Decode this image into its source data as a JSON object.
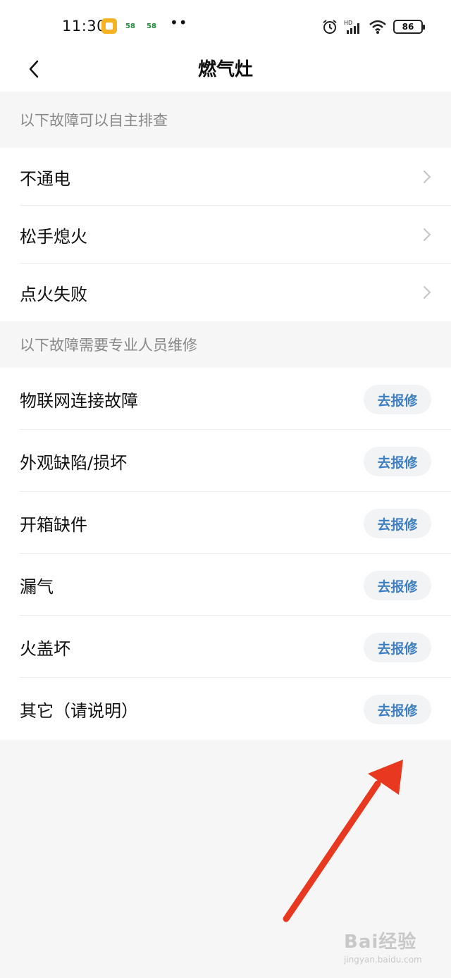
{
  "status_bar": {
    "time": "11:30",
    "app1": "",
    "app2": "58",
    "app3": "58",
    "dots": "••",
    "battery": "86"
  },
  "nav": {
    "title": "燃气灶"
  },
  "self_check": {
    "header": "以下故障可以自主排查",
    "items": [
      {
        "label": "不通电"
      },
      {
        "label": "松手熄火"
      },
      {
        "label": "点火失败"
      }
    ]
  },
  "professional": {
    "header": "以下故障需要专业人员维修",
    "button_label": "去报修",
    "items": [
      {
        "label": "物联网连接故障"
      },
      {
        "label": "外观缺陷/损坏"
      },
      {
        "label": "开箱缺件"
      },
      {
        "label": "漏气"
      },
      {
        "label": "火盖坏"
      },
      {
        "label": "其它（请说明）"
      }
    ]
  },
  "annotation": {
    "arrow_color": "#e8381f"
  },
  "watermark": {
    "top": "Bai经验",
    "bottom": "jingyan.baidu.com"
  }
}
